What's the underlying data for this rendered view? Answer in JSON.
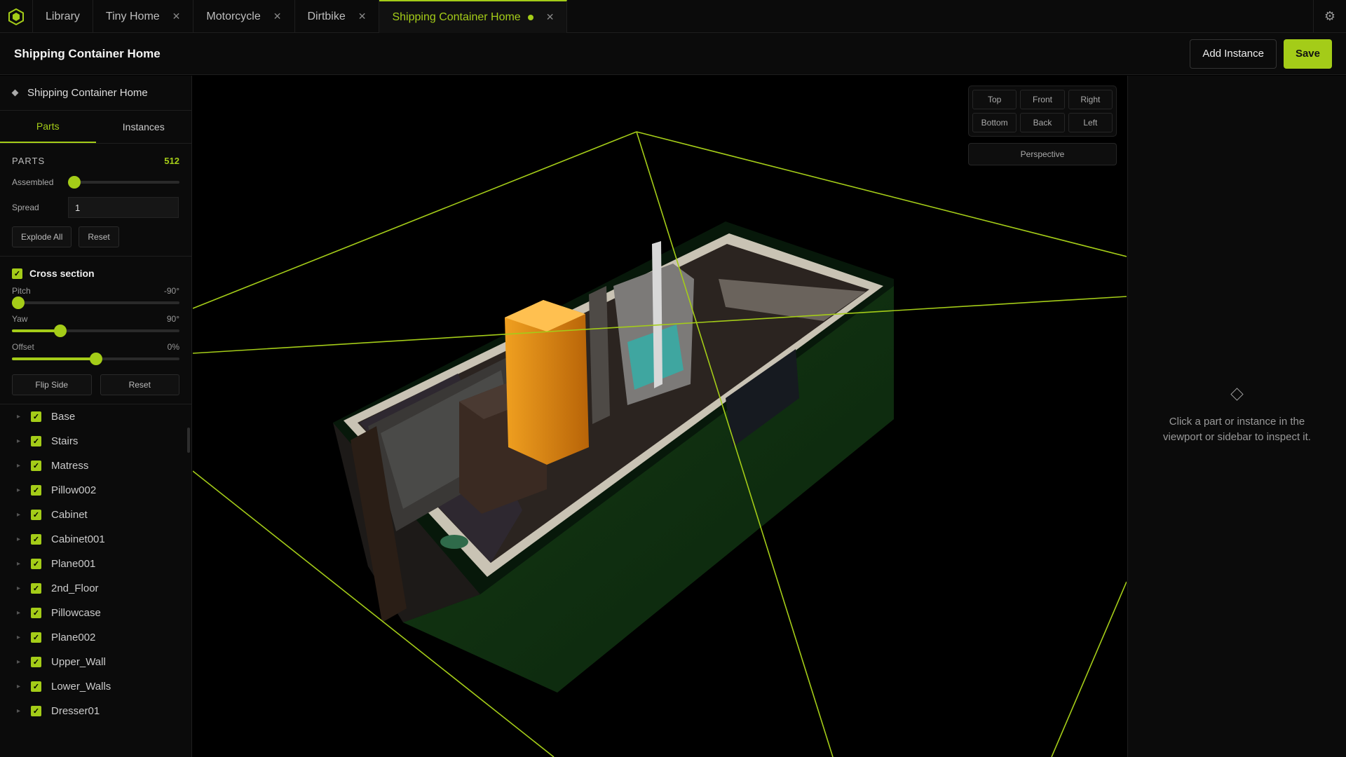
{
  "tabs": [
    {
      "label": "Library",
      "closable": false,
      "active": false
    },
    {
      "label": "Tiny Home",
      "closable": true,
      "active": false
    },
    {
      "label": "Motorcycle",
      "closable": true,
      "active": false
    },
    {
      "label": "Dirtbike",
      "closable": true,
      "active": false
    },
    {
      "label": "Shipping Container Home",
      "closable": true,
      "active": true,
      "unsaved": true
    }
  ],
  "header": {
    "title": "Shipping Container Home",
    "add_instance": "Add Instance",
    "save": "Save"
  },
  "sidebar": {
    "title": "Shipping Container Home",
    "tabs": [
      "Parts",
      "Instances"
    ],
    "parts": {
      "label": "PARTS",
      "count": "512",
      "assembled_label": "Assembled",
      "assembled_value": 0,
      "spread_label": "Spread",
      "spread_value": "1",
      "explode_all": "Explode All",
      "reset": "Reset"
    },
    "cross_section": {
      "label": "Cross section",
      "checked": true,
      "pitch_label": "Pitch",
      "pitch_value": "-90°",
      "pitch_fraction": 0.0,
      "yaw_label": "Yaw",
      "yaw_value": "90°",
      "yaw_fraction": 0.27,
      "offset_label": "Offset",
      "offset_value": "0%",
      "offset_fraction": 0.5,
      "flip_side": "Flip Side",
      "reset": "Reset"
    },
    "items": [
      "Base",
      "Stairs",
      "Matress",
      "Pillow002",
      "Cabinet",
      "Cabinet001",
      "Plane001",
      "2nd_Floor",
      "Pillowcase",
      "Plane002",
      "Upper_Wall",
      "Lower_Walls",
      "Dresser01"
    ]
  },
  "viewport": {
    "views": [
      "Top",
      "Front",
      "Right",
      "Bottom",
      "Back",
      "Left"
    ],
    "projection": "Perspective"
  },
  "inspector": {
    "empty_text": "Click a part or instance in the viewport or sidebar to inspect it."
  },
  "colors": {
    "accent": "#a4cc18",
    "background": "#000000",
    "panel": "#0b0b0b"
  },
  "icons": [
    "app-logo-icon",
    "close-icon",
    "gear-icon",
    "diamond-icon",
    "checkbox-icon",
    "caret-icon"
  ]
}
